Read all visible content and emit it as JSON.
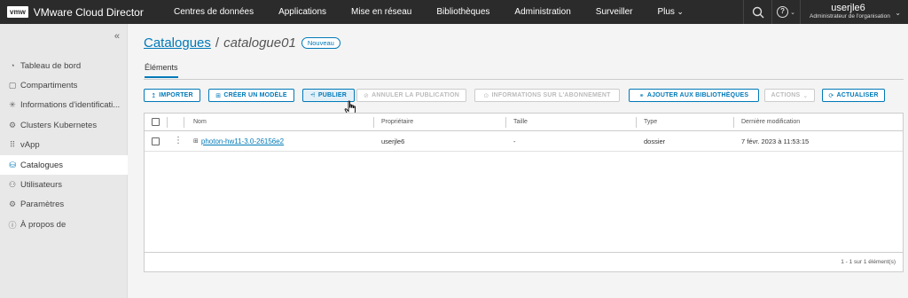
{
  "header": {
    "logo": "vmw",
    "app_name": "VMware Cloud Director",
    "nav": [
      "Centres de données",
      "Applications",
      "Mise en réseau",
      "Bibliothèques",
      "Administration",
      "Surveiller",
      "Plus"
    ],
    "user_name": "userjle6",
    "user_role": "Administrateur de l'organisation",
    "help_glyph": "?"
  },
  "sidebar": {
    "collapse_glyph": "«",
    "items": [
      {
        "label": "Tableau de bord",
        "icon": "dashboard-icon",
        "glyph": "◔"
      },
      {
        "label": "Compartiments",
        "icon": "compartments-icon",
        "glyph": "▢"
      },
      {
        "label": "Informations d'identificati...",
        "icon": "credentials-icon",
        "glyph": "✳"
      },
      {
        "label": "Clusters Kubernetes",
        "icon": "kubernetes-icon",
        "glyph": "⚙"
      },
      {
        "label": "vApp",
        "icon": "vapp-icon",
        "glyph": "⠿"
      },
      {
        "label": "Catalogues",
        "icon": "catalog-icon",
        "glyph": "⛁"
      },
      {
        "label": "Utilisateurs",
        "icon": "users-icon",
        "glyph": "⚇"
      },
      {
        "label": "Paramètres",
        "icon": "settings-icon",
        "glyph": "⚙"
      },
      {
        "label": "À propos de",
        "icon": "info-icon",
        "glyph": "ⓘ"
      }
    ],
    "active_index": 5
  },
  "breadcrumb": {
    "parent": "Catalogues",
    "separator": "/",
    "current": "catalogue01",
    "badge": "Nouveau"
  },
  "tabs": [
    "Éléments"
  ],
  "toolbar": {
    "import": {
      "icon": "↥",
      "label": "IMPORTER"
    },
    "create": {
      "icon": "⊞",
      "label": "CRÉER UN MODÈLE"
    },
    "publish": {
      "icon": "⩤",
      "label": "PUBLIER"
    },
    "unpublish": {
      "icon": "⊘",
      "label": "ANNULER LA PUBLICATION"
    },
    "subscription": {
      "icon": "⊙",
      "label": "INFORMATIONS SUR L'ABONNEMENT"
    },
    "add_libraries": {
      "icon": "⚭",
      "label": "AJOUTER AUX BIBLIOTHÈQUES"
    },
    "actions": {
      "label": "ACTIONS",
      "caret": "⌄"
    },
    "refresh": {
      "icon": "⟳",
      "label": "ACTUALISER"
    }
  },
  "table": {
    "columns": [
      "Nom",
      "Propriétaire",
      "Taille",
      "Type",
      "Dernière modification"
    ],
    "rows": [
      {
        "kebab": "⋮",
        "icon": "⊞",
        "name": "photon-hw11-3.0-26156e2",
        "owner": "userjle6",
        "size": "-",
        "type": "dossier",
        "modified": "7 févr. 2023 à 11:53:15"
      }
    ],
    "footer": "1 - 1 sur 1 élément(s)"
  },
  "colors": {
    "header_bg": "#2b2b2b",
    "accent": "#0079b8",
    "sidebar_bg": "#e8e8e8"
  }
}
